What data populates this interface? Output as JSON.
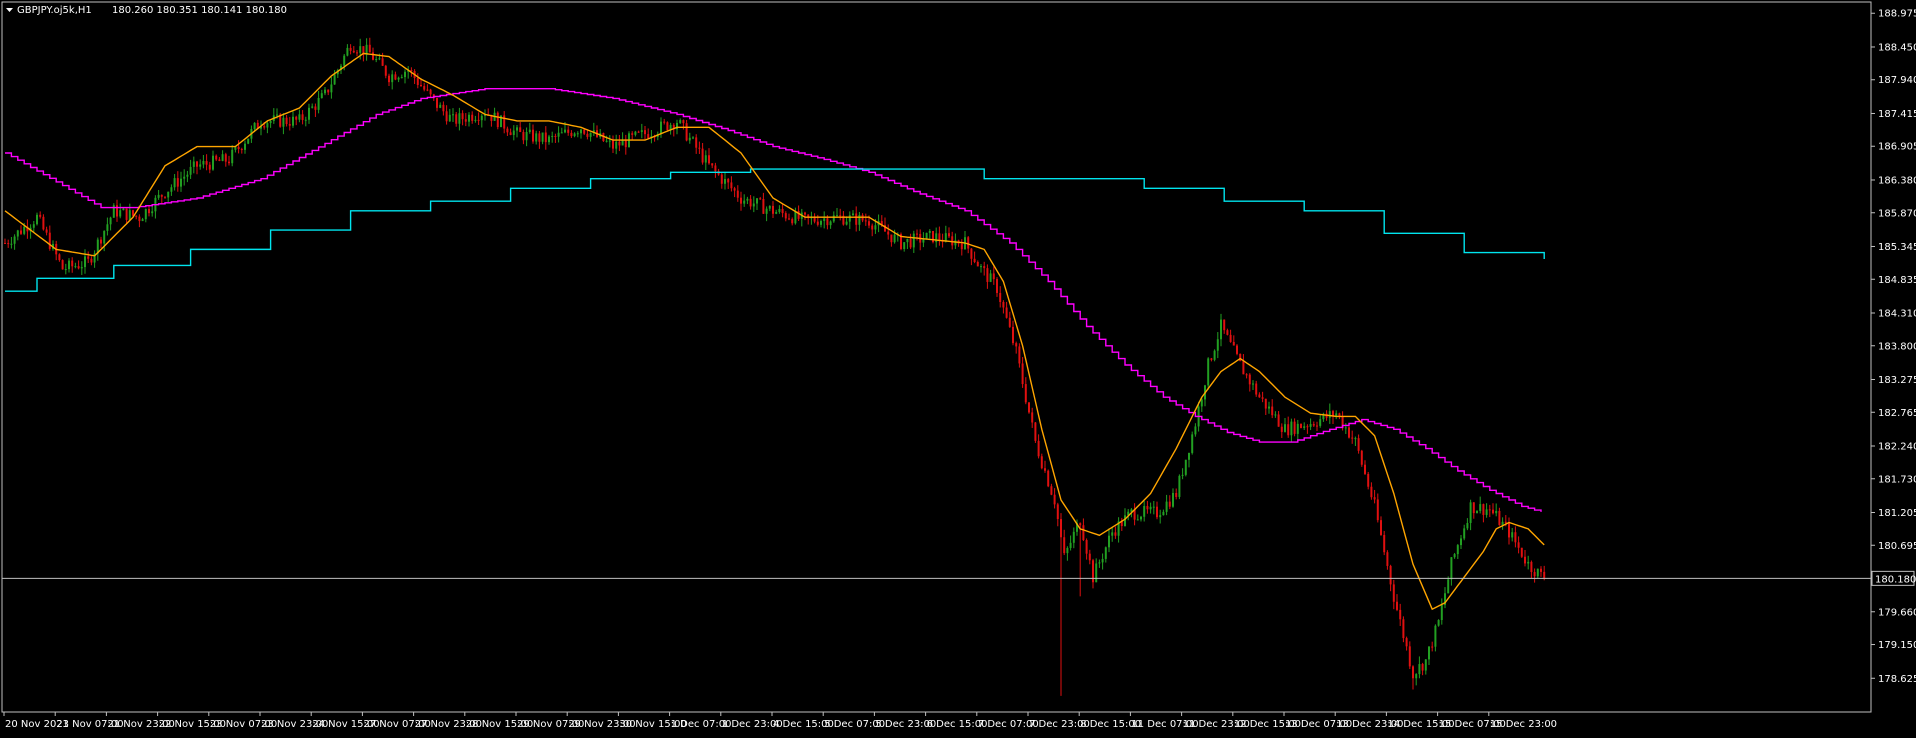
{
  "header": {
    "symbol": "GBPJPY.oj5k,H1",
    "ohlc": "180.260 180.351 180.141 180.180"
  },
  "colors": {
    "background": "#000000",
    "frame": "#c0c0c0",
    "text": "#ffffff",
    "bull_candle": "#22a022",
    "bear_candle": "#e01010",
    "fast_ma": "#ffa500",
    "slow_ma": "#ff00ff",
    "step_line": "#00e5ee",
    "bid_line": "#c0c0c0"
  },
  "chart_data": {
    "type": "candlestick",
    "ylim": [
      178.1,
      189.15
    ],
    "y_ticks": [
      "188.975",
      "188.450",
      "187.940",
      "187.415",
      "186.905",
      "186.380",
      "185.870",
      "185.345",
      "184.835",
      "184.310",
      "183.800",
      "183.275",
      "182.765",
      "182.240",
      "181.730",
      "181.205",
      "180.695",
      "179.660",
      "179.150",
      "178.625"
    ],
    "current_price": "180.180",
    "x_ticks": [
      "20 Nov 2023",
      "21 Nov 07:00",
      "21 Nov 23:00",
      "22 Nov 15:00",
      "23 Nov 07:00",
      "23 Nov 23:00",
      "24 Nov 15:00",
      "27 Nov 07:00",
      "27 Nov 23:00",
      "28 Nov 15:00",
      "29 Nov 07:00",
      "29 Nov 23:00",
      "30 Nov 15:00",
      "1 Dec 07:00",
      "1 Dec 23:00",
      "4 Dec 15:00",
      "5 Dec 07:00",
      "5 Dec 23:00",
      "6 Dec 15:00",
      "7 Dec 07:00",
      "7 Dec 23:00",
      "8 Dec 15:00",
      "11 Dec 07:00",
      "11 Dec 23:00",
      "12 Dec 15:00",
      "13 Dec 07:00",
      "13 Dec 23:00",
      "14 Dec 15:00",
      "15 Dec 07:00",
      "15 Dec 23:00"
    ],
    "bars_per_tick": 16,
    "price_anchors": [
      [
        0,
        185.4
      ],
      [
        10,
        185.8
      ],
      [
        18,
        185.0
      ],
      [
        26,
        185.1
      ],
      [
        34,
        185.9
      ],
      [
        42,
        185.8
      ],
      [
        50,
        186.2
      ],
      [
        60,
        186.6
      ],
      [
        70,
        186.7
      ],
      [
        80,
        187.3
      ],
      [
        92,
        187.3
      ],
      [
        100,
        187.7
      ],
      [
        108,
        188.5
      ],
      [
        114,
        188.35
      ],
      [
        120,
        188.0
      ],
      [
        126,
        188.1
      ],
      [
        134,
        187.6
      ],
      [
        140,
        187.3
      ],
      [
        150,
        187.45
      ],
      [
        160,
        187.1
      ],
      [
        170,
        187.0
      ],
      [
        180,
        187.2
      ],
      [
        190,
        186.9
      ],
      [
        200,
        187.1
      ],
      [
        210,
        187.3
      ],
      [
        220,
        186.6
      ],
      [
        230,
        186.1
      ],
      [
        240,
        185.9
      ],
      [
        250,
        185.75
      ],
      [
        260,
        185.8
      ],
      [
        270,
        185.75
      ],
      [
        280,
        185.4
      ],
      [
        290,
        185.5
      ],
      [
        300,
        185.4
      ],
      [
        305,
        185.0
      ],
      [
        310,
        184.7
      ],
      [
        316,
        183.7
      ],
      [
        322,
        182.3
      ],
      [
        328,
        181.4
      ],
      [
        331,
        180.5
      ],
      [
        336,
        181.1
      ],
      [
        340,
        180.2
      ],
      [
        346,
        180.9
      ],
      [
        352,
        181.2
      ],
      [
        360,
        181.2
      ],
      [
        366,
        181.5
      ],
      [
        372,
        182.6
      ],
      [
        376,
        183.5
      ],
      [
        380,
        184.1
      ],
      [
        386,
        183.5
      ],
      [
        392,
        183.0
      ],
      [
        400,
        182.5
      ],
      [
        408,
        182.6
      ],
      [
        416,
        182.75
      ],
      [
        422,
        182.3
      ],
      [
        428,
        181.3
      ],
      [
        434,
        179.9
      ],
      [
        440,
        178.7
      ],
      [
        444,
        178.9
      ],
      [
        448,
        179.5
      ],
      [
        452,
        180.4
      ],
      [
        458,
        181.3
      ],
      [
        464,
        181.25
      ],
      [
        470,
        180.9
      ],
      [
        476,
        180.4
      ],
      [
        481,
        180.18
      ]
    ],
    "fast_ma": [
      [
        0,
        185.9
      ],
      [
        16,
        185.3
      ],
      [
        28,
        185.2
      ],
      [
        40,
        185.8
      ],
      [
        50,
        186.6
      ],
      [
        60,
        186.9
      ],
      [
        72,
        186.9
      ],
      [
        82,
        187.3
      ],
      [
        92,
        187.5
      ],
      [
        102,
        188.0
      ],
      [
        112,
        188.35
      ],
      [
        120,
        188.3
      ],
      [
        130,
        187.95
      ],
      [
        140,
        187.7
      ],
      [
        150,
        187.4
      ],
      [
        160,
        187.3
      ],
      [
        170,
        187.3
      ],
      [
        180,
        187.2
      ],
      [
        190,
        187.0
      ],
      [
        200,
        187.0
      ],
      [
        210,
        187.2
      ],
      [
        220,
        187.2
      ],
      [
        230,
        186.8
      ],
      [
        240,
        186.1
      ],
      [
        250,
        185.8
      ],
      [
        260,
        185.8
      ],
      [
        270,
        185.8
      ],
      [
        280,
        185.5
      ],
      [
        290,
        185.45
      ],
      [
        300,
        185.4
      ],
      [
        306,
        185.3
      ],
      [
        312,
        184.8
      ],
      [
        318,
        183.8
      ],
      [
        324,
        182.5
      ],
      [
        330,
        181.4
      ],
      [
        336,
        180.95
      ],
      [
        342,
        180.85
      ],
      [
        350,
        181.1
      ],
      [
        358,
        181.5
      ],
      [
        366,
        182.2
      ],
      [
        374,
        183.0
      ],
      [
        380,
        183.4
      ],
      [
        386,
        183.6
      ],
      [
        392,
        183.4
      ],
      [
        400,
        183.0
      ],
      [
        408,
        182.75
      ],
      [
        416,
        182.7
      ],
      [
        422,
        182.7
      ],
      [
        428,
        182.4
      ],
      [
        434,
        181.5
      ],
      [
        440,
        180.4
      ],
      [
        446,
        179.7
      ],
      [
        450,
        179.8
      ],
      [
        456,
        180.2
      ],
      [
        462,
        180.6
      ],
      [
        466,
        180.95
      ],
      [
        470,
        181.05
      ],
      [
        476,
        180.95
      ],
      [
        481,
        180.7
      ]
    ],
    "slow_ma": [
      [
        0,
        186.8
      ],
      [
        16,
        186.35
      ],
      [
        30,
        185.95
      ],
      [
        40,
        185.95
      ],
      [
        60,
        186.1
      ],
      [
        80,
        186.4
      ],
      [
        100,
        186.95
      ],
      [
        116,
        187.4
      ],
      [
        130,
        187.65
      ],
      [
        150,
        187.8
      ],
      [
        170,
        187.8
      ],
      [
        190,
        187.65
      ],
      [
        210,
        187.4
      ],
      [
        226,
        187.15
      ],
      [
        240,
        186.9
      ],
      [
        256,
        186.7
      ],
      [
        270,
        186.5
      ],
      [
        284,
        186.2
      ],
      [
        300,
        185.9
      ],
      [
        314,
        185.4
      ],
      [
        326,
        184.8
      ],
      [
        338,
        184.1
      ],
      [
        350,
        183.5
      ],
      [
        362,
        183.0
      ],
      [
        372,
        182.7
      ],
      [
        382,
        182.45
      ],
      [
        392,
        182.3
      ],
      [
        402,
        182.3
      ],
      [
        414,
        182.5
      ],
      [
        424,
        182.65
      ],
      [
        434,
        182.5
      ],
      [
        444,
        182.2
      ],
      [
        454,
        181.85
      ],
      [
        464,
        181.55
      ],
      [
        474,
        181.3
      ],
      [
        481,
        181.2
      ]
    ],
    "step_line": [
      [
        0,
        184.65
      ],
      [
        10,
        184.85
      ],
      [
        34,
        185.05
      ],
      [
        58,
        185.3
      ],
      [
        83,
        185.6
      ],
      [
        108,
        185.9
      ],
      [
        133,
        186.05
      ],
      [
        158,
        186.25
      ],
      [
        183,
        186.4
      ],
      [
        208,
        186.5
      ],
      [
        233,
        186.55
      ],
      [
        257,
        186.55
      ],
      [
        306,
        186.4
      ],
      [
        331,
        186.4
      ],
      [
        356,
        186.25
      ],
      [
        381,
        186.05
      ],
      [
        406,
        185.9
      ],
      [
        431,
        185.55
      ],
      [
        456,
        185.25
      ],
      [
        481,
        185.15
      ]
    ]
  }
}
